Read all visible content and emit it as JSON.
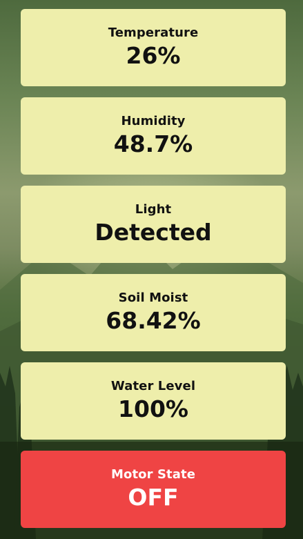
{
  "cards": [
    {
      "label": "Temperature",
      "value": "26%"
    },
    {
      "label": "Humidity",
      "value": "48.7%"
    },
    {
      "label": "Light",
      "value": "Detected"
    },
    {
      "label": "Soil Moist",
      "value": "68.42%"
    },
    {
      "label": "Water Level",
      "value": "100%"
    }
  ],
  "motor": {
    "label": "Motor State",
    "value": "OFF",
    "color": "#ef4444"
  },
  "colors": {
    "card_background": "#eeeeab",
    "text": "#111111"
  },
  "background": {
    "description_icon": "forest-mountain-scene"
  }
}
